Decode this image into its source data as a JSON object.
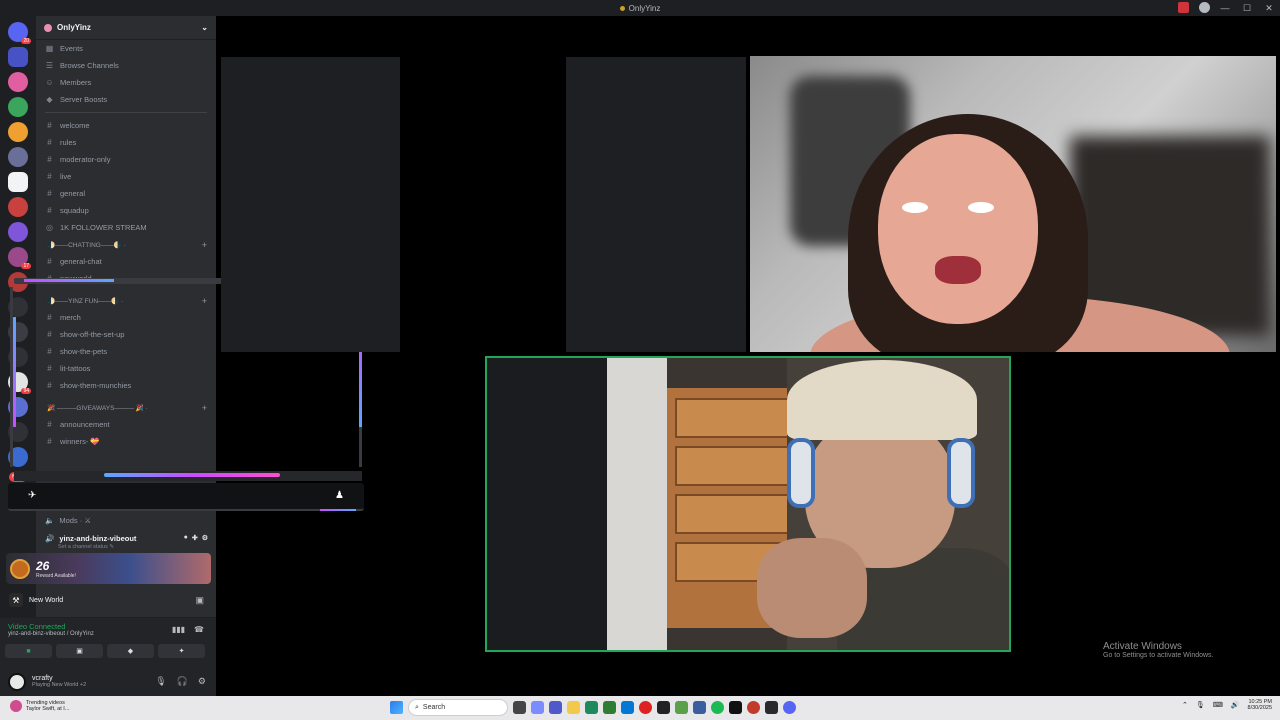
{
  "window": {
    "title": "OnlyYinz"
  },
  "server": {
    "name": "OnlyYinz",
    "menu": [
      {
        "label": "Events",
        "icon": "calendar-icon"
      },
      {
        "label": "Browse Channels",
        "icon": "browse-icon"
      },
      {
        "label": "Members",
        "icon": "members-icon"
      },
      {
        "label": "Server Boosts",
        "icon": "boost-icon"
      }
    ],
    "channels": [
      {
        "label": "welcome"
      },
      {
        "label": "rules"
      },
      {
        "label": "moderator-only"
      },
      {
        "label": "live"
      },
      {
        "label": "general"
      },
      {
        "label": "squadup"
      },
      {
        "label": "1K FOLLOWER STREAM"
      }
    ],
    "category_chatting": "🌓——CHATTING——🌗 ·",
    "chatting_channels": [
      {
        "label": "general-chat"
      },
      {
        "label": "newworld"
      }
    ],
    "category_fun": "🌓——YINZ FUN——🌗 ·",
    "fun_channels": [
      {
        "label": "merch"
      },
      {
        "label": "show-off-the-set-up"
      },
      {
        "label": "show-the-pets"
      },
      {
        "label": "lit-tattoos"
      },
      {
        "label": "show-them-munchies"
      }
    ],
    "category_giveaways": "🎉 ———GIVEAWAYS——— 🎉 ·",
    "giveaway_channels": [
      {
        "label": "announcement"
      },
      {
        "label": "winners- 💝"
      }
    ],
    "mods_label": "Mods · ⚔",
    "voice_channel": "yinz-and-binz-vibeout",
    "voice_status": "Set a channel status ✎"
  },
  "rail": {
    "badges": {
      "top": "20",
      "mid": "17",
      "low": "94"
    },
    "new_label": "NEW"
  },
  "promo": {
    "title": "26",
    "subtitle": "Reward Available!"
  },
  "activity": {
    "label": "New World"
  },
  "voice_panel": {
    "status": "Video Connected",
    "location": "yinz-and-binz-vibeout / OnlyYinz"
  },
  "user": {
    "name": "vcrafty",
    "status": "Playing New World +2"
  },
  "watermark": {
    "line1": "Activate Windows",
    "line2": "Go to Settings to activate Windows."
  },
  "taskbar": {
    "news_title": "Trending videos",
    "news_sub": "Taylor Swift, at I...",
    "search_placeholder": "Search",
    "time": "10:25 PM",
    "date": "8/30/2025"
  }
}
